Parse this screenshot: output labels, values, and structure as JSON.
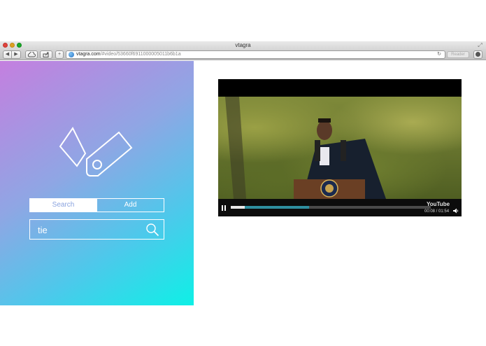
{
  "browser": {
    "window_title": "vtagra",
    "url_host": "vtagra.com",
    "url_path": "/#video/53660f6911000005011b6b1a",
    "reader_label": "Reader",
    "icons": [
      "back-arrow-icon",
      "forward-arrow-icon",
      "cloud-icon",
      "share-icon",
      "plus-icon",
      "globe-icon",
      "reload-icon",
      "download-icon",
      "fullscreen-icon"
    ]
  },
  "sidebar": {
    "logo_icon": "tags-logo-icon",
    "tabs": [
      {
        "label": "Search",
        "active": true
      },
      {
        "label": "Add",
        "active": false
      }
    ],
    "search": {
      "value": "tie",
      "icon": "magnifier-icon"
    }
  },
  "video": {
    "time": "00:08 / 01:54",
    "watermark": "YouTube",
    "progress_played": 0.07,
    "progress_buffered": 0.39
  },
  "colors": {
    "gradient_start": "#c47fdf",
    "gradient_end": "#0ef0e6",
    "tab_active_text": "#8aa3df",
    "progress_buffer": "#2f8fa0"
  }
}
